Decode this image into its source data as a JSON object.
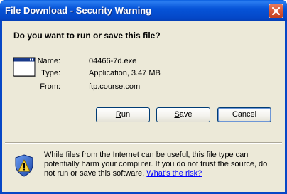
{
  "window": {
    "title": "File Download - Security Warning"
  },
  "dialog": {
    "question": "Do you want to run or save this file?",
    "file_icon": "application-window-icon",
    "fields": [
      {
        "label": "Name:",
        "value": "04466-7d.exe"
      },
      {
        "label": "Type:",
        "value": "Application, 3.47 MB"
      },
      {
        "label": "From:",
        "value": "ftp.course.com"
      }
    ],
    "buttons": {
      "run": {
        "prefix": "",
        "access": "R",
        "rest": "un"
      },
      "save": {
        "prefix": "",
        "access": "S",
        "rest": "ave"
      },
      "cancel": {
        "label": "Cancel"
      }
    },
    "warning": {
      "icon": "security-shield-warning-icon",
      "text": "While files from the Internet can be useful, this file type can potentially harm your computer. If you do not trust the source, do not run or save this software. ",
      "link": "What's the risk?"
    }
  }
}
